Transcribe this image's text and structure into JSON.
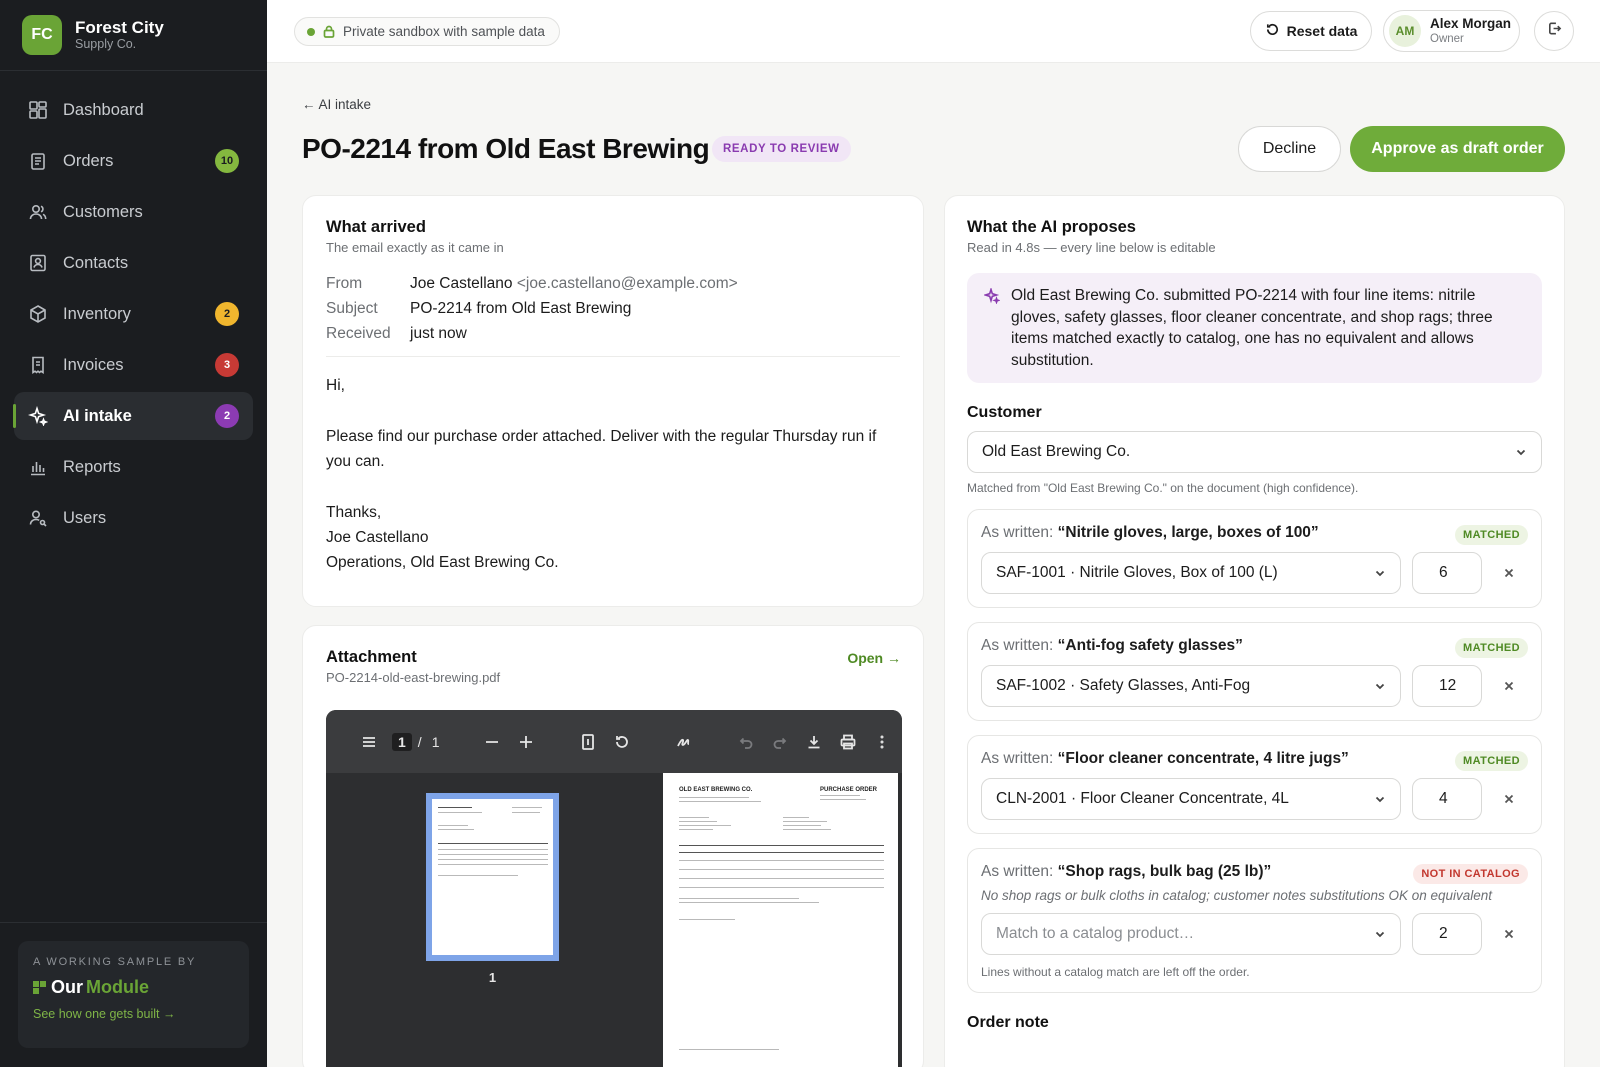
{
  "brand": {
    "initials": "FC",
    "name": "Forest City",
    "sub": "Supply Co."
  },
  "nav": [
    {
      "label": "Dashboard",
      "icon": "dashboard-icon",
      "badge": null
    },
    {
      "label": "Orders",
      "icon": "clipboard-icon",
      "badge": "10"
    },
    {
      "label": "Customers",
      "icon": "users-icon",
      "badge": null
    },
    {
      "label": "Contacts",
      "icon": "contact-card-icon",
      "badge": null
    },
    {
      "label": "Inventory",
      "icon": "box-icon",
      "badge": "2"
    },
    {
      "label": "Invoices",
      "icon": "receipt-icon",
      "badge": "3"
    },
    {
      "label": "AI intake",
      "icon": "sparkle-icon",
      "badge": "2"
    },
    {
      "label": "Reports",
      "icon": "bar-chart-icon",
      "badge": null
    },
    {
      "label": "Users",
      "icon": "user-key-icon",
      "badge": null
    }
  ],
  "sample": {
    "kicker": "A WORKING SAMPLE BY",
    "logo_a": "Our",
    "logo_b": "Module",
    "link": "See how one gets built →"
  },
  "topbar": {
    "sandbox": "Private sandbox with sample data",
    "reset": "Reset data",
    "user_initials": "AM",
    "user_name": "Alex Morgan",
    "user_role": "Owner"
  },
  "header": {
    "back": "← AI intake",
    "title": "PO-2214 from Old East Brewing",
    "status": "READY TO REVIEW",
    "decline": "Decline",
    "approve": "Approve as draft order"
  },
  "email": {
    "title": "What arrived",
    "sub": "The email exactly as it came in",
    "from_label": "From",
    "from_name": "Joe Castellano",
    "from_addr": "<joe.castellano@example.com>",
    "subject_label": "Subject",
    "subject": "PO-2214 from Old East Brewing",
    "received_label": "Received",
    "received": "just now",
    "greeting": "Hi,",
    "body": "Please find our purchase order attached. Deliver with the regular Thursday run if you can.",
    "signoff": "Thanks,",
    "sig_name": "Joe Castellano",
    "sig_role": "Operations, Old East Brewing Co."
  },
  "attachment": {
    "title": "Attachment",
    "filename": "PO-2214-old-east-brewing.pdf",
    "open": "Open →",
    "page_current": "1",
    "page_total": "1",
    "thumb_label": "1",
    "doc_company": "OLD EAST BREWING CO.",
    "doc_type": "PURCHASE ORDER"
  },
  "ai": {
    "title": "What the AI proposes",
    "sub": "Read in 4.8s — every line below is editable",
    "summary": "Old East Brewing Co. submitted PO-2214 with four line items: nitrile gloves, safety glasses, floor cleaner concentrate, and shop rags; three items matched exactly to catalog, one has no equivalent and allows substitution.",
    "customer_label": "Customer",
    "customer": "Old East Brewing Co.",
    "customer_hint": "Matched from \"Old East Brewing Co.\" on the document (high confidence).",
    "written_prefix": "As written:",
    "lines": [
      {
        "written": "“Nitrile gloves, large, boxes of 100”",
        "tag": "MATCHED",
        "product": "SAF-1001 · Nitrile Gloves, Box of 100 (L)",
        "qty": "6"
      },
      {
        "written": "“Anti-fog safety glasses”",
        "tag": "MATCHED",
        "product": "SAF-1002 · Safety Glasses, Anti-Fog",
        "qty": "12"
      },
      {
        "written": "“Floor cleaner concentrate, 4 litre jugs”",
        "tag": "MATCHED",
        "product": "CLN-2001 · Floor Cleaner Concentrate, 4L",
        "qty": "4"
      }
    ],
    "unmatched": {
      "written": "“Shop rags, bulk bag (25 lb)”",
      "tag": "NOT IN CATALOG",
      "note": "No shop rags or bulk cloths in catalog; customer notes substitutions OK on equivalent",
      "placeholder": "Match to a catalog product…",
      "qty": "2",
      "foot": "Lines without a catalog match are left off the order."
    },
    "order_note_label": "Order note"
  }
}
